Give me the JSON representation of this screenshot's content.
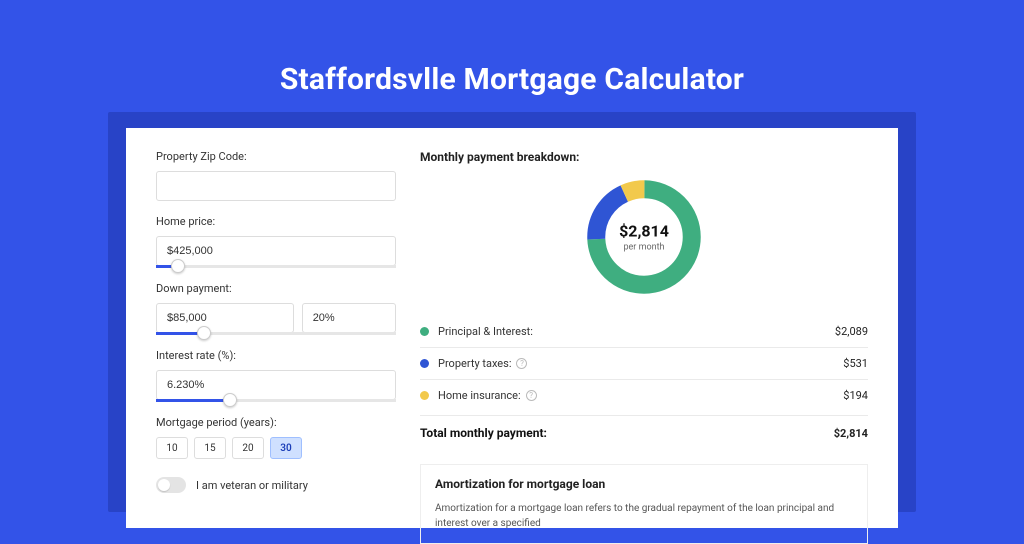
{
  "title": "Staffordsvlle Mortgage Calculator",
  "form": {
    "zip_label": "Property Zip Code:",
    "zip_value": "",
    "home_price_label": "Home price:",
    "home_price_value": "$425,000",
    "home_price_slider_pct": 9,
    "down_payment_label": "Down payment:",
    "down_payment_value": "$85,000",
    "down_payment_pct_value": "20%",
    "down_payment_slider_pct": 20,
    "interest_label": "Interest rate (%):",
    "interest_value": "6.230%",
    "interest_slider_pct": 31,
    "period_label": "Mortgage period (years):",
    "periods": [
      {
        "label": "10",
        "active": false
      },
      {
        "label": "15",
        "active": false
      },
      {
        "label": "20",
        "active": false
      },
      {
        "label": "30",
        "active": true
      }
    ],
    "veteran_label": "I am veteran or military"
  },
  "breakdown": {
    "title": "Monthly payment breakdown:",
    "total_amount": "$2,814",
    "per_month": "per month",
    "items": [
      {
        "label": "Principal & Interest:",
        "value": "$2,089",
        "color": "#3fae80",
        "info": false
      },
      {
        "label": "Property taxes:",
        "value": "$531",
        "color": "#2f55d4",
        "info": true
      },
      {
        "label": "Home insurance:",
        "value": "$194",
        "color": "#f2c94c",
        "info": true
      }
    ],
    "total_label": "Total monthly payment:",
    "total_value": "$2,814"
  },
  "amort": {
    "title": "Amortization for mortgage loan",
    "text": "Amortization for a mortgage loan refers to the gradual repayment of the loan principal and interest over a specified"
  },
  "chart_data": {
    "type": "pie",
    "title": "Monthly payment breakdown",
    "series": [
      {
        "name": "Principal & Interest",
        "value": 2089,
        "color": "#3fae80"
      },
      {
        "name": "Property taxes",
        "value": 531,
        "color": "#2f55d4"
      },
      {
        "name": "Home insurance",
        "value": 194,
        "color": "#f2c94c"
      }
    ],
    "total": 2814,
    "center_label": "$2,814",
    "center_sublabel": "per month"
  }
}
